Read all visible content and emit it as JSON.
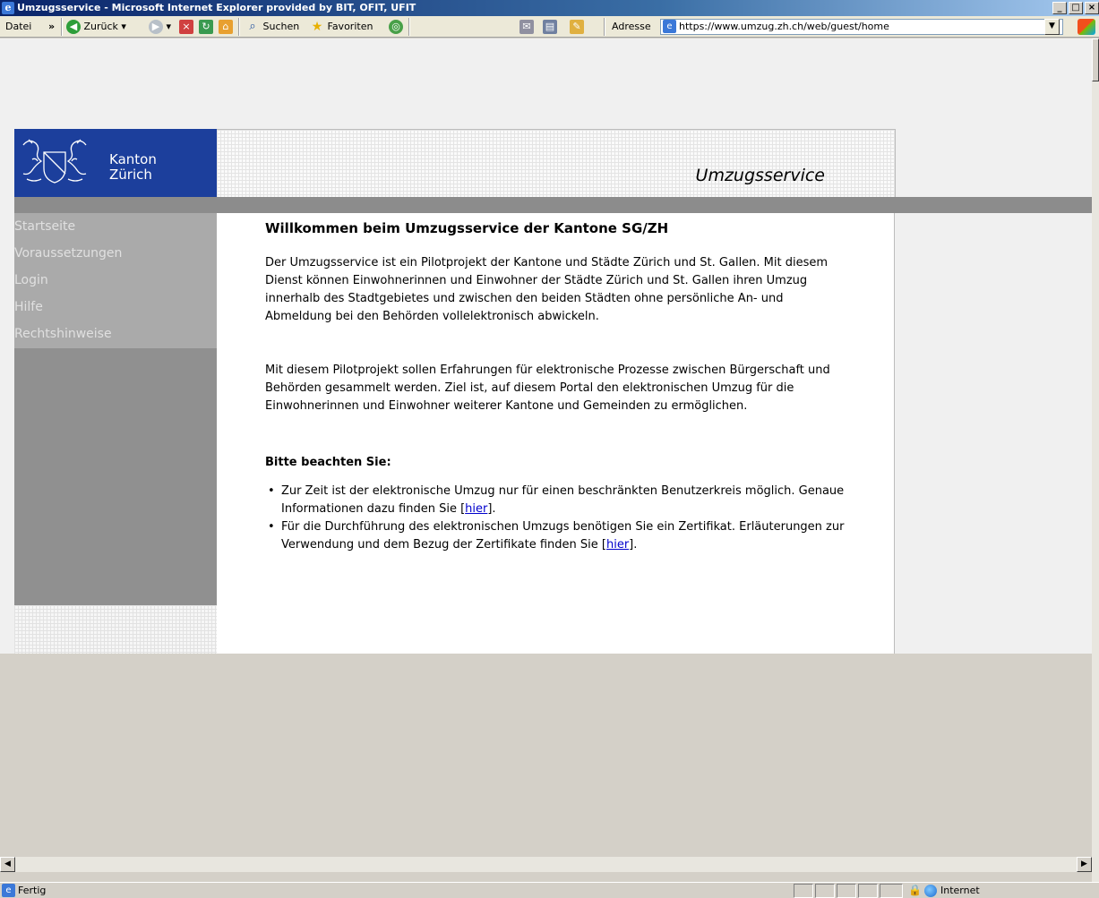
{
  "window": {
    "title": "Umzugsservice - Microsoft Internet Explorer provided by BIT, OFIT, UFIT",
    "minimize_glyph": "_",
    "maximize_glyph": "□",
    "close_glyph": "×"
  },
  "toolbar": {
    "file_menu": "Datei",
    "chevron": "»",
    "back_label": "Zurück",
    "search_label": "Suchen",
    "favorites_label": "Favoriten",
    "address_label": "Adresse",
    "address_value": "https://www.umzug.zh.ch/web/guest/home"
  },
  "header": {
    "logo_line1": "Kanton",
    "logo_line2": "Zürich",
    "service_title": "Umzugsservice"
  },
  "sidebar": {
    "items": [
      {
        "label": "Startseite"
      },
      {
        "label": "Voraussetzungen"
      },
      {
        "label": "Login"
      },
      {
        "label": "Hilfe"
      },
      {
        "label": "Rechtshinweise"
      }
    ]
  },
  "content": {
    "heading": "Willkommen beim Umzugsservice der Kantone SG/ZH",
    "paragraph1": "Der Umzugsservice ist ein Pilotprojekt der Kantone und Städte Zürich und St. Gallen. Mit diesem Dienst können Einwohnerinnen und Einwohner der Städte Zürich und St. Gallen ihren Umzug innerhalb des Stadtgebietes und zwischen den beiden Städten ohne persönliche An- und Abmeldung bei den Behörden vollelektronisch abwickeln.",
    "paragraph2": "Mit diesem Pilotprojekt sollen Erfahrungen für elektronische Prozesse zwischen Bürgerschaft und Behörden gesammelt werden. Ziel ist, auf diesem Portal den elektronischen Umzug für die Einwohnerinnen und Einwohner weiterer Kantone und Gemeinden zu ermöglichen.",
    "note_heading": "Bitte beachten Sie:",
    "bullet1_text": "Zur Zeit ist der elektronische Umzug nur für einen beschränkten Benutzerkreis möglich. Genaue Informationen dazu finden Sie [",
    "bullet1_link": "hier",
    "bullet1_end": "].",
    "bullet2_text": "Für die Durchführung des elektronischen Umzugs benötigen Sie ein Zertifikat. Erläuterungen zur Verwendung und dem Bezug der Zertifikate finden Sie [",
    "bullet2_link": "hier",
    "bullet2_end": "]."
  },
  "statusbar": {
    "status": "Fertig",
    "zone": "Internet"
  }
}
